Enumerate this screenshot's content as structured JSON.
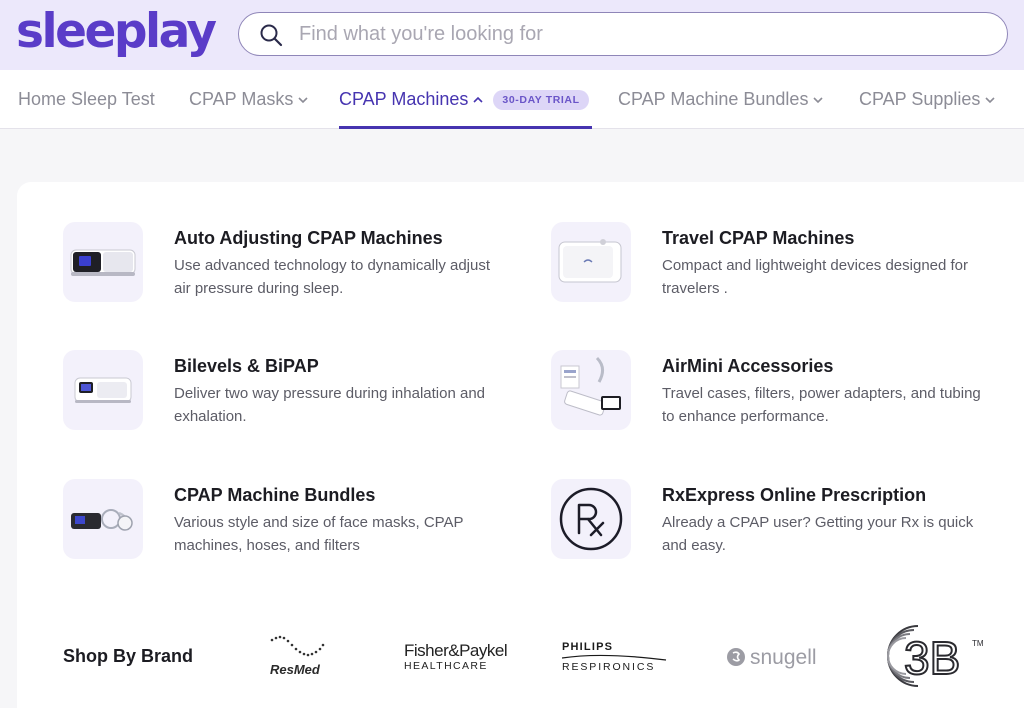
{
  "header": {
    "logo_text": "sleeplay",
    "search": {
      "placeholder": "Find what you're looking for",
      "value": ""
    }
  },
  "nav": {
    "items": [
      {
        "label": "Home Sleep Test",
        "has_dropdown": false
      },
      {
        "label": "CPAP Masks",
        "has_dropdown": true
      },
      {
        "label": "CPAP Machines",
        "has_dropdown": true,
        "active": true,
        "badge": "30-DAY TRIAL"
      },
      {
        "label": "CPAP Machine Bundles",
        "has_dropdown": true
      },
      {
        "label": "CPAP Supplies",
        "has_dropdown": true
      }
    ]
  },
  "menu": {
    "categories": [
      {
        "title": "Auto Adjusting CPAP Machines",
        "description": "Use advanced technology to dynamically adjust air pressure during sleep.",
        "icon": "auto-cpap-machine-image"
      },
      {
        "title": "Travel CPAP Machines",
        "description": "Compact and lightweight devices designed for travelers .",
        "icon": "travel-cpap-machine-image"
      },
      {
        "title": "Bilevels & BiPAP",
        "description": "Deliver two way pressure during inhalation and exhalation.",
        "icon": "bipap-machine-image"
      },
      {
        "title": "AirMini Accessories",
        "description": "Travel cases, filters, power adapters, and tubing to enhance performance.",
        "icon": "airmini-accessories-image"
      },
      {
        "title": "CPAP Machine Bundles",
        "description": "Various style and size of face masks, CPAP machines, hoses, and filters",
        "icon": "cpap-bundle-image"
      },
      {
        "title": "RxExpress Online Prescription",
        "description": "Already a CPAP user? Getting your Rx is quick and easy.",
        "icon": "rx-icon"
      }
    ]
  },
  "brands": {
    "title": "Shop By Brand",
    "items": [
      {
        "name": "ResMed",
        "logo_text": "ResMed"
      },
      {
        "name": "Fisher & Paykel Healthcare",
        "logo_text": "Fisher&Paykel",
        "logo_subtext": "HEALTHCARE"
      },
      {
        "name": "Philips Respironics",
        "logo_text": "PHILIPS",
        "logo_subtext": "RESPIRONICS"
      },
      {
        "name": "Snugell",
        "logo_text": "snugell"
      },
      {
        "name": "3B",
        "logo_text": "3B",
        "mark": "TM"
      }
    ]
  },
  "colors": {
    "brand_purple": "#5a3cc8",
    "active_nav": "#4634b0",
    "topbar_bg": "#ece8fb",
    "badge_bg": "#ddd6f7"
  }
}
